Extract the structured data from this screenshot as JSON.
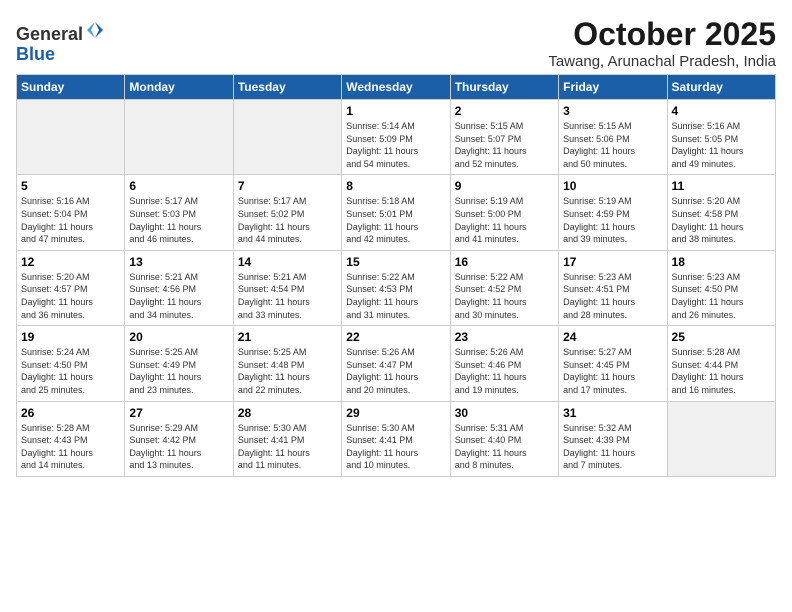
{
  "logo": {
    "general": "General",
    "blue": "Blue"
  },
  "header": {
    "month": "October 2025",
    "location": "Tawang, Arunachal Pradesh, India"
  },
  "weekdays": [
    "Sunday",
    "Monday",
    "Tuesday",
    "Wednesday",
    "Thursday",
    "Friday",
    "Saturday"
  ],
  "weeks": [
    [
      {
        "day": "",
        "info": ""
      },
      {
        "day": "",
        "info": ""
      },
      {
        "day": "",
        "info": ""
      },
      {
        "day": "1",
        "info": "Sunrise: 5:14 AM\nSunset: 5:09 PM\nDaylight: 11 hours\nand 54 minutes."
      },
      {
        "day": "2",
        "info": "Sunrise: 5:15 AM\nSunset: 5:07 PM\nDaylight: 11 hours\nand 52 minutes."
      },
      {
        "day": "3",
        "info": "Sunrise: 5:15 AM\nSunset: 5:06 PM\nDaylight: 11 hours\nand 50 minutes."
      },
      {
        "day": "4",
        "info": "Sunrise: 5:16 AM\nSunset: 5:05 PM\nDaylight: 11 hours\nand 49 minutes."
      }
    ],
    [
      {
        "day": "5",
        "info": "Sunrise: 5:16 AM\nSunset: 5:04 PM\nDaylight: 11 hours\nand 47 minutes."
      },
      {
        "day": "6",
        "info": "Sunrise: 5:17 AM\nSunset: 5:03 PM\nDaylight: 11 hours\nand 46 minutes."
      },
      {
        "day": "7",
        "info": "Sunrise: 5:17 AM\nSunset: 5:02 PM\nDaylight: 11 hours\nand 44 minutes."
      },
      {
        "day": "8",
        "info": "Sunrise: 5:18 AM\nSunset: 5:01 PM\nDaylight: 11 hours\nand 42 minutes."
      },
      {
        "day": "9",
        "info": "Sunrise: 5:19 AM\nSunset: 5:00 PM\nDaylight: 11 hours\nand 41 minutes."
      },
      {
        "day": "10",
        "info": "Sunrise: 5:19 AM\nSunset: 4:59 PM\nDaylight: 11 hours\nand 39 minutes."
      },
      {
        "day": "11",
        "info": "Sunrise: 5:20 AM\nSunset: 4:58 PM\nDaylight: 11 hours\nand 38 minutes."
      }
    ],
    [
      {
        "day": "12",
        "info": "Sunrise: 5:20 AM\nSunset: 4:57 PM\nDaylight: 11 hours\nand 36 minutes."
      },
      {
        "day": "13",
        "info": "Sunrise: 5:21 AM\nSunset: 4:56 PM\nDaylight: 11 hours\nand 34 minutes."
      },
      {
        "day": "14",
        "info": "Sunrise: 5:21 AM\nSunset: 4:54 PM\nDaylight: 11 hours\nand 33 minutes."
      },
      {
        "day": "15",
        "info": "Sunrise: 5:22 AM\nSunset: 4:53 PM\nDaylight: 11 hours\nand 31 minutes."
      },
      {
        "day": "16",
        "info": "Sunrise: 5:22 AM\nSunset: 4:52 PM\nDaylight: 11 hours\nand 30 minutes."
      },
      {
        "day": "17",
        "info": "Sunrise: 5:23 AM\nSunset: 4:51 PM\nDaylight: 11 hours\nand 28 minutes."
      },
      {
        "day": "18",
        "info": "Sunrise: 5:23 AM\nSunset: 4:50 PM\nDaylight: 11 hours\nand 26 minutes."
      }
    ],
    [
      {
        "day": "19",
        "info": "Sunrise: 5:24 AM\nSunset: 4:50 PM\nDaylight: 11 hours\nand 25 minutes."
      },
      {
        "day": "20",
        "info": "Sunrise: 5:25 AM\nSunset: 4:49 PM\nDaylight: 11 hours\nand 23 minutes."
      },
      {
        "day": "21",
        "info": "Sunrise: 5:25 AM\nSunset: 4:48 PM\nDaylight: 11 hours\nand 22 minutes."
      },
      {
        "day": "22",
        "info": "Sunrise: 5:26 AM\nSunset: 4:47 PM\nDaylight: 11 hours\nand 20 minutes."
      },
      {
        "day": "23",
        "info": "Sunrise: 5:26 AM\nSunset: 4:46 PM\nDaylight: 11 hours\nand 19 minutes."
      },
      {
        "day": "24",
        "info": "Sunrise: 5:27 AM\nSunset: 4:45 PM\nDaylight: 11 hours\nand 17 minutes."
      },
      {
        "day": "25",
        "info": "Sunrise: 5:28 AM\nSunset: 4:44 PM\nDaylight: 11 hours\nand 16 minutes."
      }
    ],
    [
      {
        "day": "26",
        "info": "Sunrise: 5:28 AM\nSunset: 4:43 PM\nDaylight: 11 hours\nand 14 minutes."
      },
      {
        "day": "27",
        "info": "Sunrise: 5:29 AM\nSunset: 4:42 PM\nDaylight: 11 hours\nand 13 minutes."
      },
      {
        "day": "28",
        "info": "Sunrise: 5:30 AM\nSunset: 4:41 PM\nDaylight: 11 hours\nand 11 minutes."
      },
      {
        "day": "29",
        "info": "Sunrise: 5:30 AM\nSunset: 4:41 PM\nDaylight: 11 hours\nand 10 minutes."
      },
      {
        "day": "30",
        "info": "Sunrise: 5:31 AM\nSunset: 4:40 PM\nDaylight: 11 hours\nand 8 minutes."
      },
      {
        "day": "31",
        "info": "Sunrise: 5:32 AM\nSunset: 4:39 PM\nDaylight: 11 hours\nand 7 minutes."
      },
      {
        "day": "",
        "info": ""
      }
    ]
  ]
}
